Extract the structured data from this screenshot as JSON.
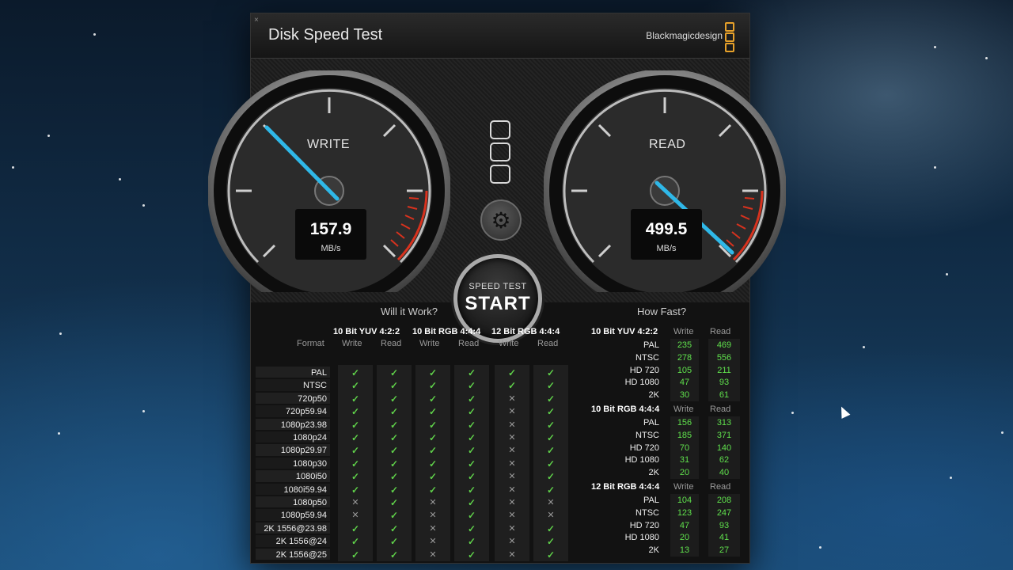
{
  "window": {
    "title": "Disk Speed Test",
    "brand": "Blackmagicdesign",
    "close_glyph": "×"
  },
  "gauges": {
    "write": {
      "label": "WRITE",
      "value": "157.9",
      "unit": "MB/s"
    },
    "read": {
      "label": "READ",
      "value": "499.5",
      "unit": "MB/s"
    }
  },
  "start_button": {
    "top_label": "SPEED TEST",
    "label": "START"
  },
  "will_it_work": {
    "title": "Will it Work?",
    "format_header": "Format",
    "groups": [
      "10 Bit YUV 4:2:2",
      "10 Bit RGB 4:4:4",
      "12 Bit RGB 4:4:4"
    ],
    "sub_headers": [
      "Write",
      "Read"
    ],
    "rows": [
      {
        "format": "PAL",
        "cells": [
          true,
          true,
          true,
          true,
          true,
          true
        ]
      },
      {
        "format": "NTSC",
        "cells": [
          true,
          true,
          true,
          true,
          true,
          true
        ]
      },
      {
        "format": "720p50",
        "cells": [
          true,
          true,
          true,
          true,
          false,
          true
        ]
      },
      {
        "format": "720p59.94",
        "cells": [
          true,
          true,
          true,
          true,
          false,
          true
        ]
      },
      {
        "format": "1080p23.98",
        "cells": [
          true,
          true,
          true,
          true,
          false,
          true
        ]
      },
      {
        "format": "1080p24",
        "cells": [
          true,
          true,
          true,
          true,
          false,
          true
        ]
      },
      {
        "format": "1080p29.97",
        "cells": [
          true,
          true,
          true,
          true,
          false,
          true
        ]
      },
      {
        "format": "1080p30",
        "cells": [
          true,
          true,
          true,
          true,
          false,
          true
        ]
      },
      {
        "format": "1080i50",
        "cells": [
          true,
          true,
          true,
          true,
          false,
          true
        ]
      },
      {
        "format": "1080i59.94",
        "cells": [
          true,
          true,
          true,
          true,
          false,
          true
        ]
      },
      {
        "format": "1080p50",
        "cells": [
          false,
          true,
          false,
          true,
          false,
          false
        ]
      },
      {
        "format": "1080p59.94",
        "cells": [
          false,
          true,
          false,
          true,
          false,
          false
        ]
      },
      {
        "format": "2K 1556@23.98",
        "cells": [
          true,
          true,
          false,
          true,
          false,
          true
        ]
      },
      {
        "format": "2K 1556@24",
        "cells": [
          true,
          true,
          false,
          true,
          false,
          true
        ]
      },
      {
        "format": "2K 1556@25",
        "cells": [
          true,
          true,
          false,
          true,
          false,
          true
        ]
      }
    ]
  },
  "how_fast": {
    "title": "How Fast?",
    "groups": [
      {
        "name": "10 Bit YUV 4:2:2",
        "write_label": "Write",
        "read_label": "Read",
        "rows": [
          {
            "format": "PAL",
            "write": "235",
            "read": "469"
          },
          {
            "format": "NTSC",
            "write": "278",
            "read": "556"
          },
          {
            "format": "HD 720",
            "write": "105",
            "read": "211"
          },
          {
            "format": "HD 1080",
            "write": "47",
            "read": "93"
          },
          {
            "format": "2K",
            "write": "30",
            "read": "61"
          }
        ]
      },
      {
        "name": "10 Bit RGB 4:4:4",
        "write_label": "Write",
        "read_label": "Read",
        "rows": [
          {
            "format": "PAL",
            "write": "156",
            "read": "313"
          },
          {
            "format": "NTSC",
            "write": "185",
            "read": "371"
          },
          {
            "format": "HD 720",
            "write": "70",
            "read": "140"
          },
          {
            "format": "HD 1080",
            "write": "31",
            "read": "62"
          },
          {
            "format": "2K",
            "write": "20",
            "read": "40"
          }
        ]
      },
      {
        "name": "12 Bit RGB 4:4:4",
        "write_label": "Write",
        "read_label": "Read",
        "rows": [
          {
            "format": "PAL",
            "write": "104",
            "read": "208"
          },
          {
            "format": "NTSC",
            "write": "123",
            "read": "247"
          },
          {
            "format": "HD 720",
            "write": "47",
            "read": "93"
          },
          {
            "format": "HD 1080",
            "write": "20",
            "read": "41"
          },
          {
            "format": "2K",
            "write": "13",
            "read": "27"
          }
        ]
      }
    ]
  },
  "icons": {
    "ok": "✓",
    "no": "✕",
    "gear": "⚙"
  },
  "colors": {
    "accent_needle": "#2fb8e8",
    "ok_green": "#5fd04a",
    "logo_orange": "#e7a12a",
    "redline": "#d8321e"
  }
}
